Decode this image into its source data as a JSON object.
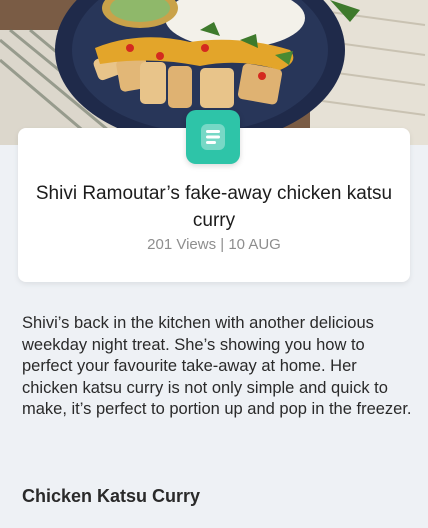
{
  "article": {
    "title": "Shivi Ramoutar’s fake-away chicken katsu curry",
    "views": "201 Views",
    "separator": " | ",
    "date": "10 AUG",
    "body": "Shivi’s back in the kitchen with another delicious weekday night treat. She’s showing you how to perfect your favourite take-away at home. Her chicken katsu curry is not only simple and quick to make, it’s perfect to portion up and pop in the freezer.",
    "section_heading": "Chicken Katsu Curry"
  },
  "badge": {
    "icon": "document-icon",
    "color": "#2ec4a8"
  },
  "hero": {
    "image": "food-photo"
  }
}
